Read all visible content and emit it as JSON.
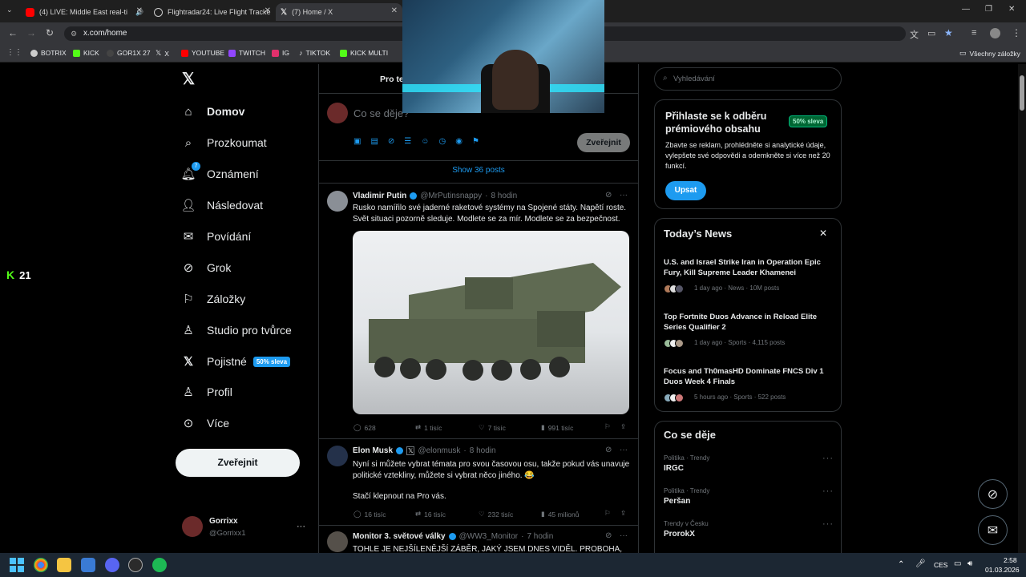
{
  "browser": {
    "tabs": [
      {
        "title": "(4) LIVE: Middle East real-ti"
      },
      {
        "title": "Flightradar24: Live Flight Tracke"
      },
      {
        "title": "(7) Home / X"
      }
    ],
    "url": "x.com/home",
    "bookmarks": [
      "BOTRIX",
      "KICK",
      "GOR1X 27",
      "X",
      "YOUTUBE",
      "TWITCH",
      "IG",
      "TIKTOK",
      "KICK MULTI"
    ],
    "all_bookmarks": "Všechny záložky"
  },
  "overlay": {
    "kick_count": "21"
  },
  "nav": {
    "items": [
      {
        "label": "Domov"
      },
      {
        "label": "Prozkoumat"
      },
      {
        "label": "Oznámení",
        "badge": "7"
      },
      {
        "label": "Následovat"
      },
      {
        "label": "Povídání"
      },
      {
        "label": "Grok"
      },
      {
        "label": "Záložky"
      },
      {
        "label": "Studio pro tvůrce"
      },
      {
        "label": "Pojistné",
        "badge": "50% sleva"
      },
      {
        "label": "Profil"
      },
      {
        "label": "Více"
      }
    ],
    "post_button": "Zveřejnit",
    "profile": {
      "name": "Gorrixx",
      "handle": "@Gorrixx1"
    }
  },
  "feed": {
    "tab": "Pro te",
    "composer_placeholder": "Co se děje?",
    "composer_post": "Zveřejnit",
    "show_posts": "Show 36 posts",
    "tweets": [
      {
        "name": "Vladimir Putin",
        "handle": "@MrPutinsnappy",
        "time": "8 hodin",
        "text_line1": "Rusko namířilo své jaderné raketové systémy na Spojené státy. Napětí roste.",
        "text_line2": "Svět situaci pozorně sleduje. Modlete se za mír. Modlete se za bezpečnost.",
        "replies": "628",
        "reposts": "1 tisíc",
        "likes": "7 tisíc",
        "views": "991 tisíc"
      },
      {
        "name": "Elon Musk",
        "handle": "@elonmusk",
        "time": "8 hodin",
        "text_line1": "Nyní si můžete vybrat témata pro svou časovou osu, takže pokud vás unavuje",
        "text_line2": "politické vztekliny, můžete si vybrat něco jiného. 😂",
        "text_line3": "Stačí klepnout na Pro vás.",
        "replies": "16 tisíc",
        "reposts": "16 tisíc",
        "likes": "232 tisíc",
        "views": "45 milionů"
      },
      {
        "name": "Monitor 3. světové války",
        "handle": "@WW3_Monitor",
        "time": "7 hodin",
        "text_line1": "TOHLE JE NEJŠÍLENĚJŠÍ ZÁBĚR, JAKÝ JSEM DNES VIDĚL. PROBOHA, TO"
      }
    ]
  },
  "sidebar": {
    "search_placeholder": "Vyhledávání",
    "premium": {
      "title": "Přihlaste se k odběru prémiového obsahu",
      "badge": "50% sleva",
      "body": "Zbavte se reklam, prohlédněte si analytické údaje, vylepšete své odpovědi a odemkněte si více než 20 funkcí.",
      "button": "Upsat"
    },
    "news": {
      "title": "Today’s News",
      "items": [
        {
          "headline": "U.S. and Israel Strike Iran in Operation Epic Fury, Kill Supreme Leader Khamenei",
          "meta": "1 day ago · News · 10M posts"
        },
        {
          "headline": "Top Fortnite Duos Advance in Reload Elite Series Qualifier 2",
          "meta": "1 day ago · Sports · 4,115 posts"
        },
        {
          "headline": "Focus and Th0masHD Dominate FNCS Div 1 Duos Week 4 Finals",
          "meta": "5 hours ago · Sports · 522 posts"
        }
      ]
    },
    "trends": {
      "title": "Co se děje",
      "items": [
        {
          "category": "Politika · Trendy",
          "name": "IRGC"
        },
        {
          "category": "Politika · Trendy",
          "name": "Peršan"
        },
        {
          "category": "Trendy v Česku",
          "name": "ProrokX"
        }
      ]
    }
  },
  "taskbar": {
    "lang": "CES",
    "time": "2:58",
    "date": "01.03.2026"
  },
  "colors": {
    "accent": "#1d9bf0",
    "bg": "#000000",
    "border": "#2f3336",
    "premium_badge": "#00ba7c"
  }
}
